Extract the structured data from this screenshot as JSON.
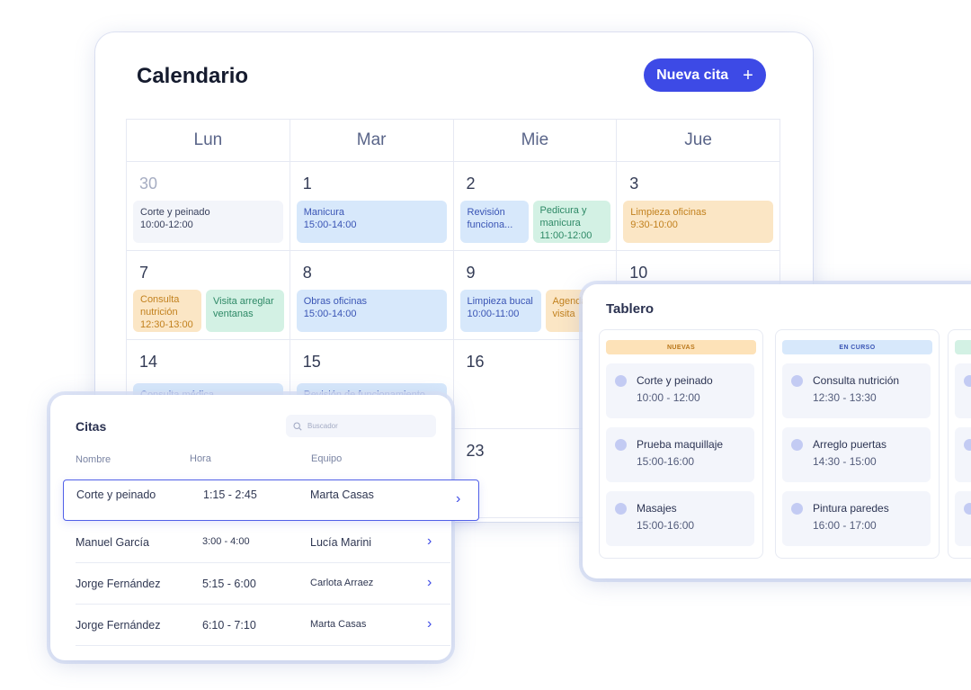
{
  "calendar": {
    "title": "Calendario",
    "new_button": "Nueva cita",
    "new_button_icon": "plus-icon",
    "weekdays": [
      "Lun",
      "Mar",
      "Mie",
      "Jue"
    ],
    "rows": [
      [
        {
          "day": "30",
          "events": [
            {
              "text": "Corte y peinado\n10:00-12:00",
              "color": "gray"
            }
          ]
        },
        {
          "day": "1",
          "events": [
            {
              "text": "Manicura\n15:00-14:00",
              "color": "blue"
            }
          ]
        },
        {
          "day": "2",
          "events": [
            {
              "text": "Revisión funciona...",
              "color": "blue"
            },
            {
              "text": "Pedicura y manicura\n11:00-12:00",
              "color": "green"
            }
          ]
        },
        {
          "day": "3",
          "events": [
            {
              "text": "Limpieza oficinas\n9:30-10:00",
              "color": "orange"
            }
          ]
        }
      ],
      [
        {
          "day": "7",
          "events": [
            {
              "text": "Consulta nutrición\n12:30-13:00",
              "color": "orange"
            },
            {
              "text": "Visita arreglar ventanas",
              "color": "green"
            }
          ]
        },
        {
          "day": "8",
          "events": [
            {
              "text": "Obras oficinas\n15:00-14:00",
              "color": "blue"
            }
          ]
        },
        {
          "day": "9",
          "events": [
            {
              "text": "Limpieza bucal\n10:00-11:00",
              "color": "blue"
            },
            {
              "text": "Agenda visita",
              "color": "orange"
            }
          ]
        },
        {
          "day": "10",
          "events": []
        }
      ],
      [
        {
          "day": "14",
          "events": [
            {
              "text": "Consulta médica",
              "color": "blue"
            }
          ]
        },
        {
          "day": "15",
          "events": [
            {
              "text": "Revisión de funcionamiento",
              "color": "blue"
            }
          ]
        },
        {
          "day": "16",
          "events": []
        },
        {
          "day": "",
          "events": []
        }
      ],
      [
        {
          "day": "",
          "events": []
        },
        {
          "day": "",
          "events": []
        },
        {
          "day": "23",
          "events": []
        },
        {
          "day": "",
          "events": []
        }
      ]
    ]
  },
  "tablero": {
    "title": "Tablero",
    "columns": [
      {
        "label": "NUEVAS",
        "color": "orange",
        "tasks": [
          {
            "name": "Corte y peinado",
            "time": "10:00 - 12:00"
          },
          {
            "name": "Prueba maquillaje",
            "time": "15:00-16:00"
          },
          {
            "name": "Masajes",
            "time": "15:00-16:00"
          }
        ]
      },
      {
        "label": "EN CURSO",
        "color": "blue",
        "tasks": [
          {
            "name": "Consulta nutrición",
            "time": "12:30 - 13:30"
          },
          {
            "name": "Arreglo puertas",
            "time": "14:30 - 15:00"
          },
          {
            "name": "Pintura paredes",
            "time": "16:00 - 17:00"
          }
        ]
      },
      {
        "label": "",
        "color": "green",
        "tasks": [
          {
            "name": "",
            "time": ""
          },
          {
            "name": "",
            "time": ""
          },
          {
            "name": "",
            "time": ""
          }
        ]
      }
    ]
  },
  "citas": {
    "title": "Citas",
    "search_placeholder": "Buscador",
    "headers": {
      "name": "Nombre",
      "hour": "Hora",
      "team": "Equipo"
    },
    "rows": [
      {
        "name": "Corte y peinado",
        "hour": "1:15 - 2:45",
        "team": "Marta Casas",
        "selected": true
      },
      {
        "name": "Manuel García",
        "hour": "3:00 - 4:00",
        "team": "Lucía Marini"
      },
      {
        "name": "Jorge Fernández",
        "hour": "5:15 - 6:00",
        "team": "Carlota Arraez"
      },
      {
        "name": "Jorge Fernández",
        "hour": "6:10 - 7:10",
        "team": "Marta Casas"
      }
    ]
  },
  "colors": {
    "accent": "#3d4ae6",
    "event_blue": "#d7e8fb",
    "event_green": "#d3f1e4",
    "event_orange": "#fbe6c5"
  }
}
